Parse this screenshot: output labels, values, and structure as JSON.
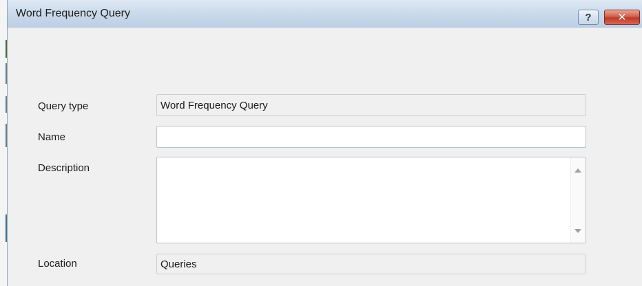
{
  "window": {
    "title": "Word Frequency Query",
    "help_label": "?",
    "close_label": "✕"
  },
  "form": {
    "query_type_label": "Query type",
    "query_type_value": "Word Frequency Query",
    "name_label": "Name",
    "name_value": "",
    "description_label": "Description",
    "description_value": "",
    "location_label": "Location",
    "location_value": "Queries"
  }
}
